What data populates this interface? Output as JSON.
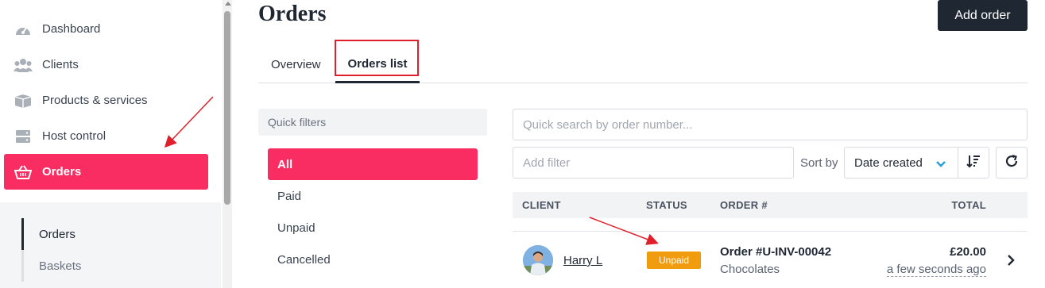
{
  "sidebar": {
    "items": [
      {
        "label": "Dashboard",
        "icon": "dashboard-icon"
      },
      {
        "label": "Clients",
        "icon": "users-icon"
      },
      {
        "label": "Products & services",
        "icon": "box-icon"
      },
      {
        "label": "Host control",
        "icon": "server-icon"
      },
      {
        "label": "Orders",
        "icon": "basket-icon",
        "active": true
      }
    ],
    "subnav": [
      {
        "label": "Orders",
        "active": true
      },
      {
        "label": "Baskets"
      }
    ]
  },
  "header": {
    "title": "Orders",
    "add_button": "Add order"
  },
  "tabs": [
    {
      "label": "Overview"
    },
    {
      "label": "Orders list",
      "active": true
    }
  ],
  "quick_filters": {
    "title": "Quick filters",
    "items": [
      "All",
      "Paid",
      "Unpaid",
      "Cancelled"
    ],
    "active": "All"
  },
  "search": {
    "placeholder": "Quick search by order number...",
    "filter_placeholder": "Add filter",
    "sort_label": "Sort by",
    "sort_value": "Date created"
  },
  "table": {
    "columns": [
      "CLIENT",
      "STATUS",
      "ORDER #",
      "TOTAL"
    ],
    "rows": [
      {
        "client": "Harry L",
        "status": "Unpaid",
        "order_number": "Order #U-INV-00042",
        "description": "Chocolates",
        "total": "£20.00",
        "time": "a few seconds ago"
      }
    ]
  },
  "colors": {
    "accent": "#fa2d63",
    "dark": "#1f2733",
    "status_unpaid": "#f19c0f",
    "annotation": "#e01f2a"
  }
}
